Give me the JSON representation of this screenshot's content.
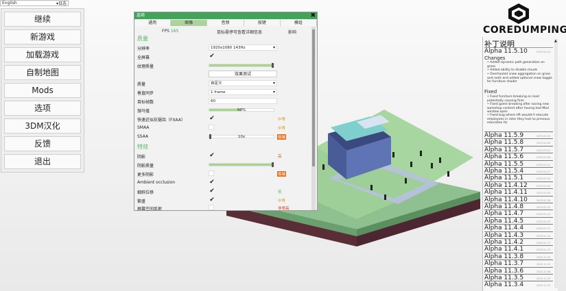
{
  "language": {
    "selected": "English",
    "option": "日志"
  },
  "main_menu": [
    "继续",
    "新游戏",
    "加载游戏",
    "自制地图",
    "Mods",
    "选项",
    "3DM汉化",
    "反馈",
    "退出"
  ],
  "dialog": {
    "title": "选项",
    "close_glyph": "✖",
    "tabs": [
      "通用",
      "图像",
      "音频",
      "按键",
      "模组"
    ],
    "active_tab": "图像",
    "fps_label": "FPS",
    "fps_value": "165",
    "hover_hint": "鼠标悬停可查看详细信息",
    "impact_header": "影响",
    "section_quality": "质量",
    "section_effects": "特效",
    "resolution_label": "分辨率",
    "resolution_value": "1920x1080 143Hz",
    "fullscreen_label": "全屏幕",
    "texture_label": "纹理质量",
    "texture_level": 1.0,
    "benchmark_button": "效果测试",
    "quality_label": "质量",
    "quality_value": "自定义",
    "vsync_label": "垂直同步",
    "vsync_value": "1 frame",
    "target_fps_label": "目标帧数",
    "target_fps_value": "60",
    "gamma_label": "伽马值",
    "gamma_value": "50%",
    "gamma_level": 0.5,
    "fxaa_label": "快速近似抗锯齿（FXAA）",
    "fxaa_impact": "中等",
    "smaa_label": "SMAA",
    "smaa_impact": "中等",
    "ssaa_label": "SSAA",
    "ssaa_value": "10x",
    "ssaa_impact": "极端",
    "shadows_label": "阴影",
    "shadows_impact": "高",
    "shadow_quality_label": "阴影质量",
    "shadow_quality_level": 1.0,
    "more_shadows_label": "更多阴影",
    "more_shadows_impact": "极端",
    "ao_label": "Ambient occlusion",
    "outline_label": "细斜位移",
    "outline_impact": "低",
    "bloom_label": "繁盛",
    "bloom_impact": "中等",
    "ssr_label": "屏幕空间反射",
    "ssr_impact": "非常高"
  },
  "logo": "COREDUMPING",
  "patch_notes": {
    "title": "补丁说明",
    "latest_version": "Alpha 11.5.10",
    "latest_date": "2023-04-20",
    "changes_title": "Changes",
    "changes": [
      "• Added dynamic path generation on grass",
      "• Added ability to disable clouds",
      "• Overhauled snow aggregation on grass and roofs and added optional snow toggle for furniture shader"
    ],
    "fixed_title": "Fixed",
    "fixed": [
      "• Fixed furniture breaking on load potentially causing fires",
      "• Fixed game breaking after saving new workshop content after having had Mod window open",
      "• Fixed bug where HR wouldn't educate employees in roles they had no previous education for"
    ],
    "versions": [
      {
        "name": "Alpha 11.5.9",
        "date": "2023-04-09"
      },
      {
        "name": "Alpha 11.5.8",
        "date": "2023-04-04"
      },
      {
        "name": "Alpha 11.5.7",
        "date": "2023-03-31"
      },
      {
        "name": "Alpha 11.5.6",
        "date": "2023-03-28"
      },
      {
        "name": "Alpha 11.5.5",
        "date": "2023-03-21"
      },
      {
        "name": "Alpha 11.5.4",
        "date": "2023-03-17"
      },
      {
        "name": "Alpha 11.5.1",
        "date": "2023-03-14"
      },
      {
        "name": "Alpha 11.4.12",
        "date": "2023-03-09"
      },
      {
        "name": "Alpha 11.4.11",
        "date": "2023-03-03"
      },
      {
        "name": "Alpha 11.4.10",
        "date": "2023-02-28"
      },
      {
        "name": "Alpha 11.4.8",
        "date": "2023-02-22"
      },
      {
        "name": "Alpha 11.4.7",
        "date": "2023-02-14"
      },
      {
        "name": "Alpha 11.4.5",
        "date": "2023-02-07"
      },
      {
        "name": "Alpha 11.4.4",
        "date": "2023-01-31"
      },
      {
        "name": "Alpha 11.4.3",
        "date": "2023-01-24"
      },
      {
        "name": "Alpha 11.4.2",
        "date": "2023-01-17"
      },
      {
        "name": "Alpha 11.4.1",
        "date": "2023-01-10"
      },
      {
        "name": "Alpha 11.3.8",
        "date": "2022-12-20"
      },
      {
        "name": "Alpha 11.3.7",
        "date": "2022-12-13"
      },
      {
        "name": "Alpha 11.3.6",
        "date": "2022-12-06"
      },
      {
        "name": "Alpha 11.3.5",
        "date": "2022-11-29"
      },
      {
        "name": "Alpha 11.3.4",
        "date": "2022-11-22"
      }
    ]
  }
}
